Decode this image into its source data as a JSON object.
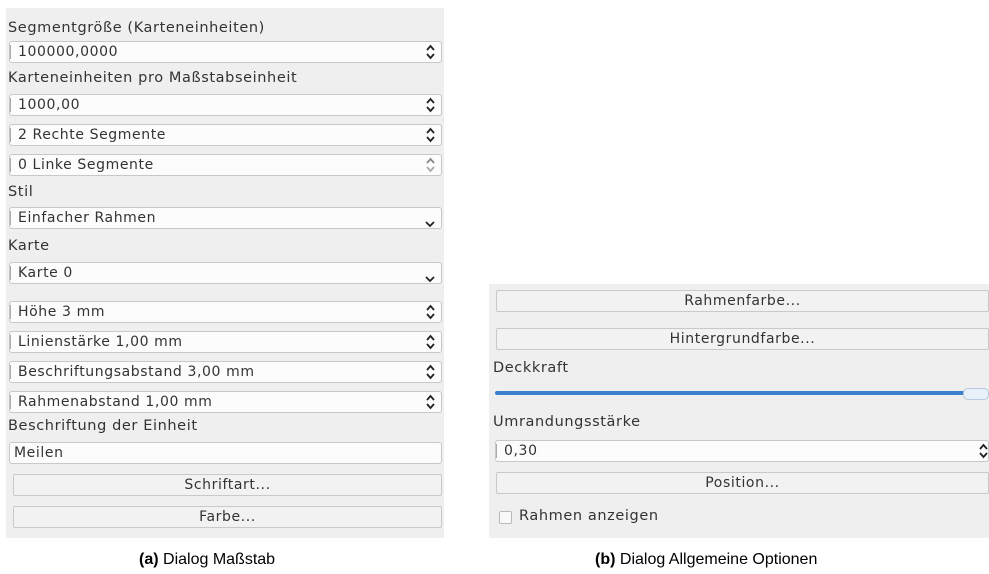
{
  "scale_dialog": {
    "segment_size_label": "Segmentgröße (Karteneinheiten)",
    "segment_size_value": "100000,0000",
    "map_units_label": "Karteneinheiten pro Maßstabseinheit",
    "map_units_value": "1000,00",
    "right_segments": "2 Rechte Segmente",
    "left_segments": "0 Linke Segmente",
    "style_label": "Stil",
    "style_value": "Einfacher Rahmen",
    "map_label": "Karte",
    "map_value": "Karte 0",
    "height": "Höhe 3 mm",
    "line_width": "Linienstärke 1,00 mm",
    "label_spacing": "Beschriftungsabstand 3,00 mm",
    "box_spacing": "Rahmenabstand 1,00 mm",
    "unit_label_label": "Beschriftung der Einheit",
    "unit_label_value": "Meilen",
    "font_button": "Schriftart...",
    "color_button": "Farbe..."
  },
  "general_dialog": {
    "frame_color_button": "Rahmenfarbe...",
    "background_color_button": "Hintergrundfarbe...",
    "opacity_label": "Deckkraft",
    "opacity_value": 1.0,
    "outline_width_label": "Umrandungsstärke",
    "outline_width_value": "0,30",
    "position_button": "Position...",
    "show_frame_label": "Rahmen anzeigen",
    "show_frame_checked": false
  },
  "captions": {
    "a_tag": "(a)",
    "a_text": " Dialog Maßstab",
    "b_tag": "(b)",
    "b_text": " Dialog Allgemeine Optionen"
  }
}
